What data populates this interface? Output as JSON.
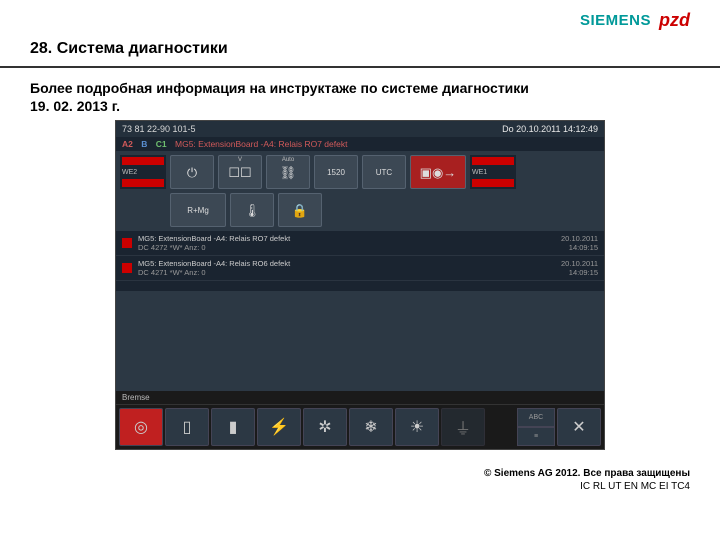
{
  "slide": {
    "number_title": "28. Система диагностики",
    "subtitle_line1": "Более подробная информация на инструктаже по системе диагностики",
    "subtitle_line2": "19. 02. 2013 г.",
    "copyright": "© Siemens AG 2012. Все права защищены",
    "department": "IC RL UT EN MC EI TC4"
  },
  "logos": {
    "siemens": "SIEMENS",
    "rzd": "pzd"
  },
  "hmi": {
    "header": {
      "train_id": "73 81 22-90 101-5",
      "datetime": "Do 20.10.2011 14:12:49",
      "cars": {
        "a2": "A2",
        "b": "B",
        "c1": "C1"
      },
      "fault_line": "MG5: ExtensionBoard -A4: Relais RO7 defekt"
    },
    "labels": {
      "we2": "WE2",
      "we1": "WE1",
      "brake": "R+Mg",
      "gauge": "1520",
      "utc": "UTC",
      "auto": "Auto",
      "v": "V",
      "bremse": "Bremse",
      "abc": "ABC"
    },
    "log": [
      {
        "text": "MG5: ExtensionBoard -A4: Relais RO7 defekt",
        "sub": "DC 4272 *W* Anz: 0",
        "date": "20.10.2011",
        "time": "14:09:15"
      },
      {
        "text": "MG5: ExtensionBoard -A4: Relais RO6 defekt",
        "sub": "DC 4271 *W* Anz: 0",
        "date": "20.10.2011",
        "time": "14:09:15"
      }
    ],
    "footer_icons": {
      "brake": "disc-brake-icon",
      "door": "door-icon",
      "battery": "battery-icon",
      "bolt": "bolt-icon",
      "fan": "fan-icon",
      "snow": "snowflake-icon",
      "bulb": "bulb-icon",
      "plug": "plug-icon",
      "close": "✕"
    }
  }
}
